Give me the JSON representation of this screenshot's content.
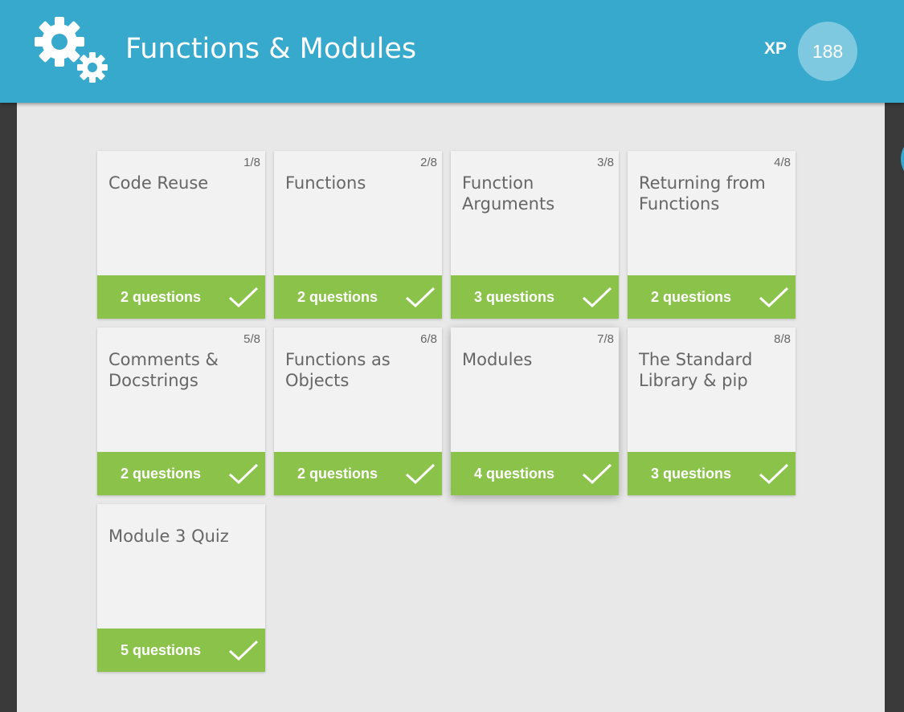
{
  "header": {
    "title": "Functions & Modules",
    "xp_label": "XP",
    "xp_value": "188",
    "icon": "gears-icon",
    "background_color": "#36a9cc"
  },
  "colors": {
    "card_footer": "#8bc34a",
    "card_background": "#f2f2f2",
    "page_background": "#e8e8e8"
  },
  "lessons": [
    {
      "number": "1/8",
      "title": "Code Reuse",
      "questions": "2 questions",
      "completed": true
    },
    {
      "number": "2/8",
      "title": "Functions",
      "questions": "2 questions",
      "completed": true
    },
    {
      "number": "3/8",
      "title": "Function Arguments",
      "questions": "3 questions",
      "completed": true
    },
    {
      "number": "4/8",
      "title": "Returning from Functions",
      "questions": "2 questions",
      "completed": true
    },
    {
      "number": "5/8",
      "title": "Comments & Docstrings",
      "questions": "2 questions",
      "completed": true
    },
    {
      "number": "6/8",
      "title": "Functions as Objects",
      "questions": "2 questions",
      "completed": true
    },
    {
      "number": "7/8",
      "title": "Modules",
      "questions": "4 questions",
      "completed": true
    },
    {
      "number": "8/8",
      "title": "The Standard Library & pip",
      "questions": "3 questions",
      "completed": true
    },
    {
      "number": "",
      "title": "Module 3 Quiz",
      "questions": "5 questions",
      "completed": true
    }
  ]
}
